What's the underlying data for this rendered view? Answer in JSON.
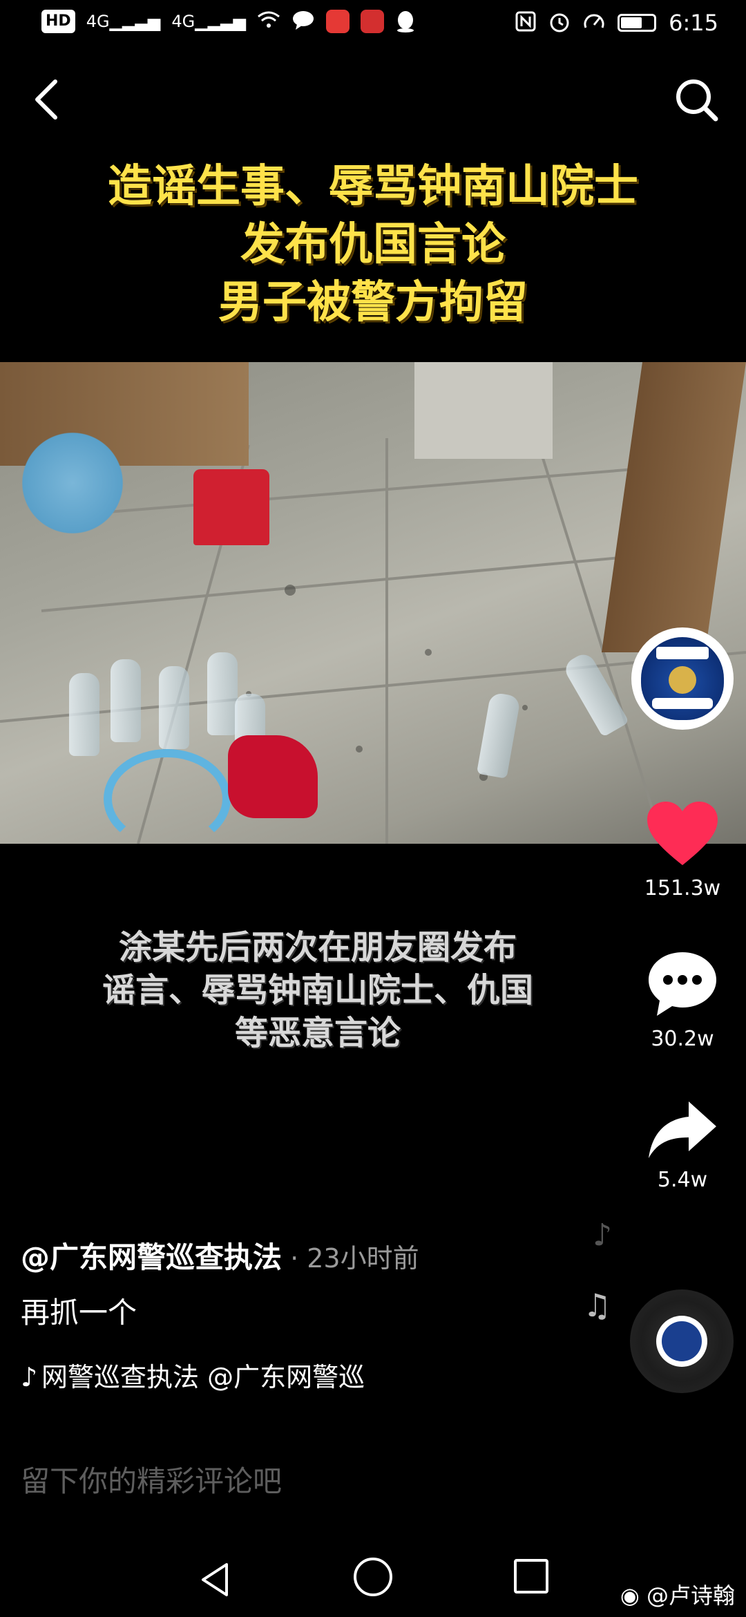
{
  "status_bar": {
    "network_label": "HD",
    "signal_label_1": "4G",
    "signal_label_2": "4G",
    "time": "6:15"
  },
  "video": {
    "headline_lines": [
      "造谣生事、辱骂钟南山院士",
      "发布仇国言论",
      "男子被警方拘留"
    ],
    "subtitle_lines": [
      "涂某先后两次在朋友圈发布",
      "谣言、辱骂钟南山院士、仇国",
      "等恶意言论"
    ],
    "badge_top_text": "广东网警",
    "badge_bottom_text": "POLICE"
  },
  "actions": {
    "likes": "151.3w",
    "comments": "30.2w",
    "shares": "5.4w",
    "like_color": "#fe2c55"
  },
  "post": {
    "author": "@广东网警巡查执法",
    "time_ago": " · 23小时前",
    "caption": "再抓一个",
    "music_ticker": "网警巡查执法    @广东网警巡"
  },
  "comment_placeholder": "留下你的精彩评论吧",
  "watermark": "@卢诗翰"
}
